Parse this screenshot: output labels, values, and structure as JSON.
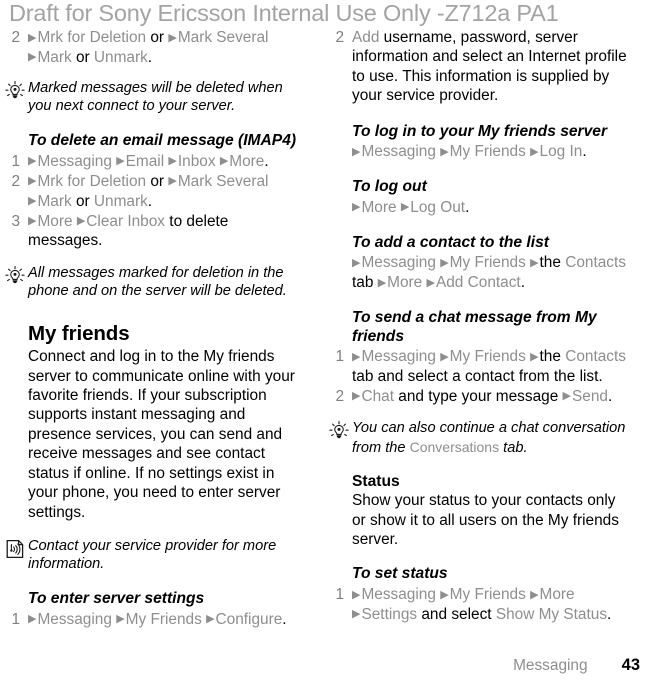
{
  "watermark": "Draft for Sony Ericsson Internal Use Only -Z712a PA1",
  "footer": {
    "section_label": "Messaging",
    "page_number": "43"
  },
  "icons": {
    "tip": "lightbulb-icon",
    "note": "service-provider-icon"
  },
  "left_column": {
    "step_pop_mark": {
      "number": "2",
      "seg_1_arrow": "▶",
      "seg_1_menu": "Mrk for Deletion",
      "seg_2_text": "or",
      "seg_2_arrow": "▶",
      "seg_2_menu": "Mark Several",
      "seg_3_arrow": "▶",
      "seg_3_menu": "Mark",
      "seg_4_text": "or",
      "seg_4_menu": "Unmark",
      "seg_end": "."
    },
    "tip_marked_messages": "Marked messages will be deleted when you next connect to your server.",
    "heading_delete_imap4": "To delete an email message (IMAP4)",
    "step_imap4_1": {
      "number": "1",
      "a_arrow": "▶",
      "a_menu": "Messaging",
      "b_arrow": "▶",
      "b_menu": "Email",
      "c_arrow": "▶",
      "c_menu": "Inbox",
      "d_arrow": "▶",
      "d_menu": "More",
      "end": "."
    },
    "step_imap4_2": {
      "number": "2",
      "seg_1_arrow": "▶",
      "seg_1_menu": "Mrk for Deletion",
      "seg_2_text": "or",
      "seg_2_arrow": "▶",
      "seg_2_menu": "Mark Several",
      "seg_3_arrow": "▶",
      "seg_3_menu": "Mark",
      "seg_4_text": "or",
      "seg_4_menu": "Unmark",
      "seg_end": "."
    },
    "step_imap4_3": {
      "number": "3",
      "a_arrow": "▶",
      "a_menu": "More",
      "b_arrow": "▶",
      "b_menu": "Clear Inbox",
      "tail": "to delete messages."
    },
    "note_all_messages": "All messages marked for deletion in the phone and on the server will be deleted.",
    "heading_my_friends": "My friends",
    "para_my_friends": "Connect and log in to the My friends server to communicate online with your favorite friends. If your subscription supports instant messaging and presence services, you can send and receive messages and see contact status if online. If no settings exist in your phone, you need to enter server settings.",
    "note_contact_provider": "Contact your service provider for more information.",
    "heading_enter_server_settings": "To enter server settings",
    "step_server_settings_1": {
      "number": "1",
      "a_arrow": "▶",
      "a_menu": "Messaging",
      "b_arrow": "▶",
      "b_menu": "My Friends",
      "c_arrow": "▶",
      "c_menu": "Configure",
      "end": "."
    }
  },
  "right_column": {
    "step_add_credentials": {
      "number": "2",
      "menu": "Add",
      "text": "username, password, server information and select an Internet profile to use. This information is supplied by your service provider."
    },
    "heading_log_in": "To log in to your My friends server",
    "path_log_in": {
      "a_arrow": "▶",
      "a_menu": "Messaging",
      "b_arrow": "▶",
      "b_menu": "My Friends",
      "c_arrow": "▶",
      "c_menu": "Log In",
      "end": "."
    },
    "heading_log_out": "To log out",
    "path_log_out": {
      "a_arrow": "▶",
      "a_menu": "More",
      "b_arrow": "▶",
      "b_menu": "Log Out",
      "end": "."
    },
    "heading_add_contact": "To add a contact to the list",
    "path_add_contact": {
      "a_arrow": "▶",
      "a_menu": "Messaging",
      "b_arrow": "▶",
      "b_menu": "My Friends",
      "c_arrow": "▶",
      "c_text": "the",
      "c_menu": "Contacts",
      "d_text": "tab",
      "d_arrow": "▶",
      "d_menu": "More",
      "e_arrow": "▶",
      "e_menu": "Add Contact",
      "end": "."
    },
    "heading_send_chat": "To send a chat message from My friends",
    "step_send_chat_1": {
      "number": "1",
      "a_arrow": "▶",
      "a_menu": "Messaging",
      "b_arrow": "▶",
      "b_menu": "My Friends",
      "c_arrow": "▶",
      "c_text": "the",
      "c_menu": "Contacts",
      "tail": "tab and select a contact from the list."
    },
    "step_send_chat_2": {
      "number": "2",
      "a_arrow": "▶",
      "a_menu": "Chat",
      "mid_text": "and type your message",
      "b_arrow": "▶",
      "b_menu": "Send",
      "end": "."
    },
    "tip_conversations": {
      "part_1": "You can also continue a chat conversation from the",
      "menu": "Conversations",
      "part_2": "tab."
    },
    "heading_status": "Status",
    "para_status": "Show your status to your contacts only or show it to all users on the My friends server.",
    "heading_set_status": "To set status",
    "step_set_status_1": {
      "number": "1",
      "a_arrow": "▶",
      "a_menu": "Messaging",
      "b_arrow": "▶",
      "b_menu": "My Friends",
      "c_arrow": "▶",
      "c_menu": "More",
      "d_arrow": "▶",
      "d_menu": "Settings",
      "mid_text": "and select",
      "e_menu": "Show My Status",
      "end": "."
    }
  }
}
